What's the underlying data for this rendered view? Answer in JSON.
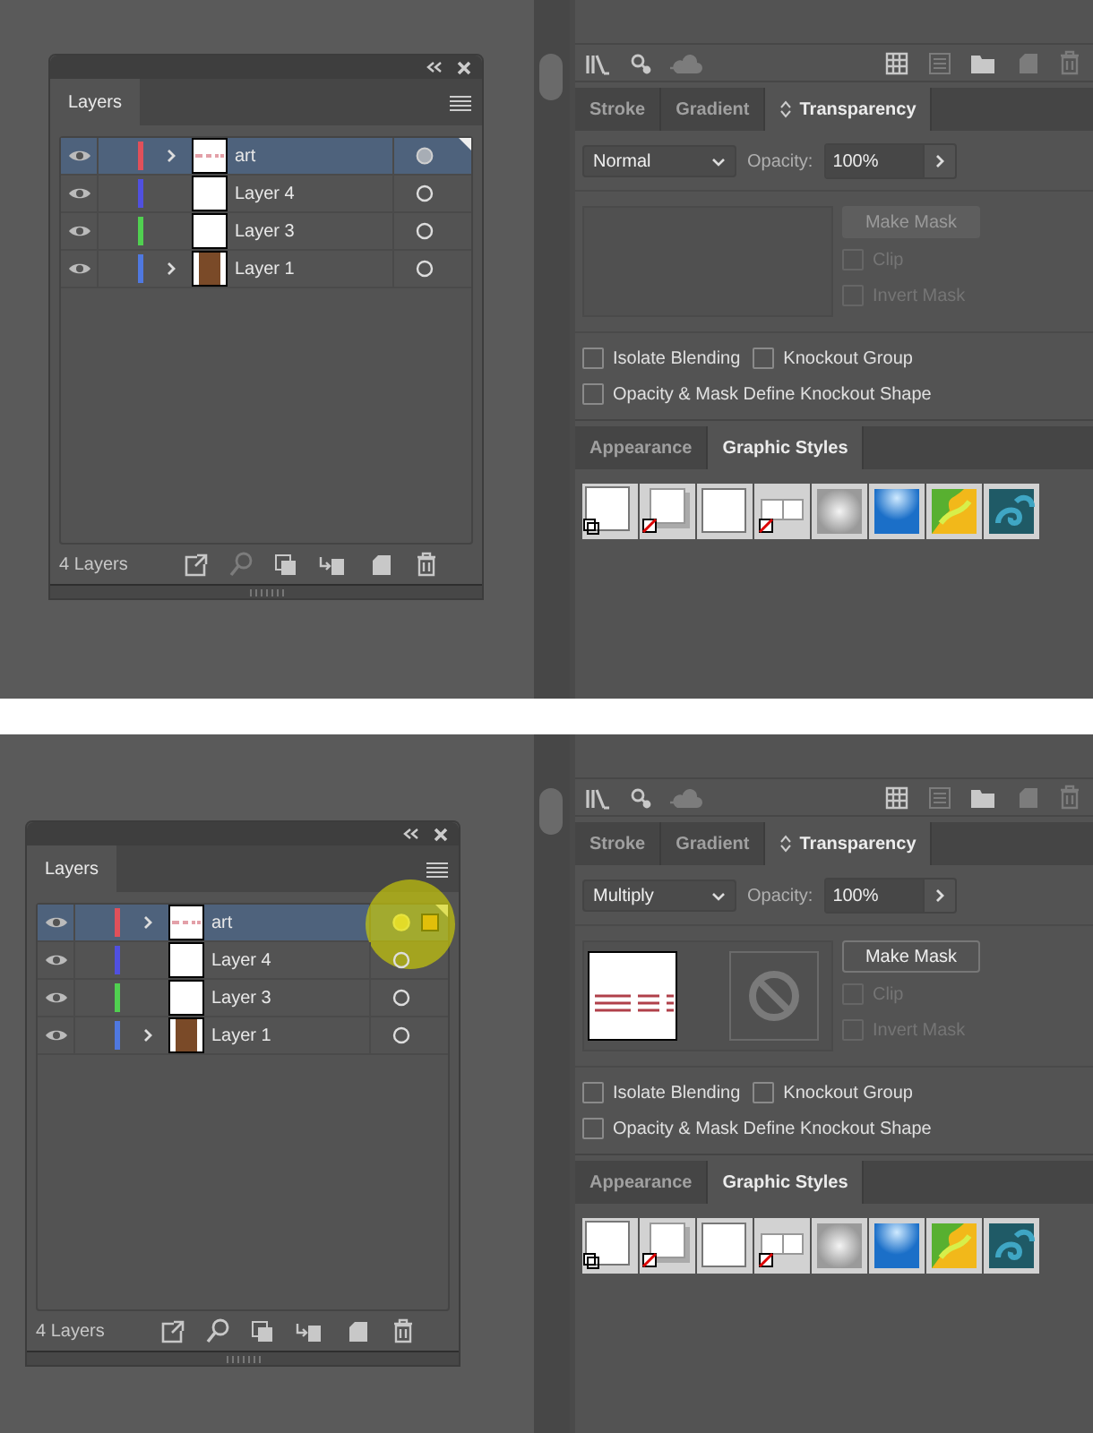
{
  "scenes": [
    {
      "layers_panel": {
        "title": "Layers",
        "footer_count": "4 Layers",
        "layers": [
          {
            "name": "art",
            "color": "#e0505a",
            "visible": true,
            "expandable": true,
            "selected": true,
            "kind": "art",
            "targeted": true,
            "has_selected_art": false,
            "highlighted": false
          },
          {
            "name": "Layer 4",
            "color": "#5050e0",
            "visible": true,
            "expandable": false,
            "selected": false,
            "kind": "blank",
            "targeted": false,
            "has_selected_art": false,
            "highlighted": false
          },
          {
            "name": "Layer 3",
            "color": "#50d050",
            "visible": true,
            "expandable": false,
            "selected": false,
            "kind": "blank",
            "targeted": false,
            "has_selected_art": false,
            "highlighted": false
          },
          {
            "name": "Layer 1",
            "color": "#4f78e0",
            "visible": true,
            "expandable": true,
            "selected": false,
            "kind": "brown",
            "targeted": false,
            "has_selected_art": false,
            "highlighted": false
          }
        ],
        "footer_tools": [
          {
            "kind": "export",
            "disabled": false
          },
          {
            "kind": "search",
            "disabled": true
          },
          {
            "kind": "mask",
            "disabled": false
          },
          {
            "kind": "sublayer",
            "disabled": false
          },
          {
            "kind": "new",
            "disabled": false
          },
          {
            "kind": "delete",
            "disabled": false
          }
        ]
      },
      "toolbar": [
        {
          "kind": "libraries",
          "disabled": false
        },
        {
          "kind": "link",
          "disabled": false
        },
        {
          "kind": "cloud",
          "disabled": true
        },
        {
          "kind": "grid",
          "disabled": false
        },
        {
          "kind": "list",
          "disabled": true
        },
        {
          "kind": "folder",
          "disabled": false
        },
        {
          "kind": "new",
          "disabled": true
        },
        {
          "kind": "delete",
          "disabled": true
        }
      ],
      "transparency_panel": {
        "tabs": [
          {
            "label": "Stroke",
            "selected": false
          },
          {
            "label": "Gradient",
            "selected": false
          },
          {
            "label": "Transparency",
            "selected": true
          }
        ],
        "blend_mode": "Normal",
        "opacity_label": "Opacity:",
        "opacity": "100%",
        "mask": {
          "object_thumbnail": false,
          "make_mask": "Make Mask",
          "make_mask_enabled": false,
          "options": [
            {
              "label": "Clip",
              "checked": false,
              "disabled": true
            },
            {
              "label": "Invert Mask",
              "checked": false,
              "disabled": true
            }
          ]
        },
        "option_rows": [
          [
            {
              "label": "Isolate Blending",
              "checked": false
            },
            {
              "label": "Knockout Group",
              "checked": false
            }
          ],
          [
            {
              "label": "Opacity & Mask Define Knockout Shape",
              "checked": false
            }
          ]
        ]
      },
      "styles_panel": {
        "tabs": [
          {
            "label": "Appearance",
            "selected": false
          },
          {
            "label": "Graphic Styles",
            "selected": true
          }
        ],
        "styles": [
          {
            "kind": "default"
          },
          {
            "kind": "shadow"
          },
          {
            "kind": "plain"
          },
          {
            "kind": "split"
          },
          {
            "kind": "soft"
          },
          {
            "kind": "blue"
          },
          {
            "kind": "green"
          },
          {
            "kind": "teal"
          }
        ]
      }
    },
    {
      "layers_panel": {
        "title": "Layers",
        "footer_count": "4 Layers",
        "layers": [
          {
            "name": "art",
            "color": "#e0505a",
            "visible": true,
            "expandable": true,
            "selected": true,
            "kind": "art",
            "targeted": true,
            "has_selected_art": true,
            "highlighted": true
          },
          {
            "name": "Layer 4",
            "color": "#5050e0",
            "visible": true,
            "expandable": false,
            "selected": false,
            "kind": "blank",
            "targeted": false,
            "has_selected_art": false,
            "highlighted": false
          },
          {
            "name": "Layer 3",
            "color": "#50d050",
            "visible": true,
            "expandable": false,
            "selected": false,
            "kind": "blank",
            "targeted": false,
            "has_selected_art": false,
            "highlighted": false
          },
          {
            "name": "Layer 1",
            "color": "#4f78e0",
            "visible": true,
            "expandable": true,
            "selected": false,
            "kind": "brown",
            "targeted": false,
            "has_selected_art": false,
            "highlighted": false
          }
        ],
        "footer_tools": [
          {
            "kind": "export",
            "disabled": false
          },
          {
            "kind": "search",
            "disabled": false
          },
          {
            "kind": "mask",
            "disabled": false
          },
          {
            "kind": "sublayer",
            "disabled": false
          },
          {
            "kind": "new",
            "disabled": false
          },
          {
            "kind": "delete",
            "disabled": false
          }
        ]
      },
      "toolbar": [
        {
          "kind": "libraries",
          "disabled": false
        },
        {
          "kind": "link",
          "disabled": false
        },
        {
          "kind": "cloud",
          "disabled": true
        },
        {
          "kind": "grid",
          "disabled": false
        },
        {
          "kind": "list",
          "disabled": true
        },
        {
          "kind": "folder",
          "disabled": false
        },
        {
          "kind": "new",
          "disabled": true
        },
        {
          "kind": "delete",
          "disabled": true
        }
      ],
      "transparency_panel": {
        "tabs": [
          {
            "label": "Stroke",
            "selected": false
          },
          {
            "label": "Gradient",
            "selected": false
          },
          {
            "label": "Transparency",
            "selected": true
          }
        ],
        "blend_mode": "Multiply",
        "opacity_label": "Opacity:",
        "opacity": "100%",
        "mask": {
          "object_thumbnail": true,
          "make_mask": "Make Mask",
          "make_mask_enabled": true,
          "options": [
            {
              "label": "Clip",
              "checked": false,
              "disabled": true
            },
            {
              "label": "Invert Mask",
              "checked": false,
              "disabled": true
            }
          ]
        },
        "option_rows": [
          [
            {
              "label": "Isolate Blending",
              "checked": false
            },
            {
              "label": "Knockout Group",
              "checked": false
            }
          ],
          [
            {
              "label": "Opacity & Mask Define Knockout Shape",
              "checked": false
            }
          ]
        ]
      },
      "styles_panel": {
        "tabs": [
          {
            "label": "Appearance",
            "selected": false
          },
          {
            "label": "Graphic Styles",
            "selected": true
          }
        ],
        "styles": [
          {
            "kind": "default"
          },
          {
            "kind": "shadow"
          },
          {
            "kind": "plain"
          },
          {
            "kind": "split"
          },
          {
            "kind": "soft"
          },
          {
            "kind": "blue"
          },
          {
            "kind": "green"
          },
          {
            "kind": "teal"
          }
        ]
      }
    }
  ]
}
